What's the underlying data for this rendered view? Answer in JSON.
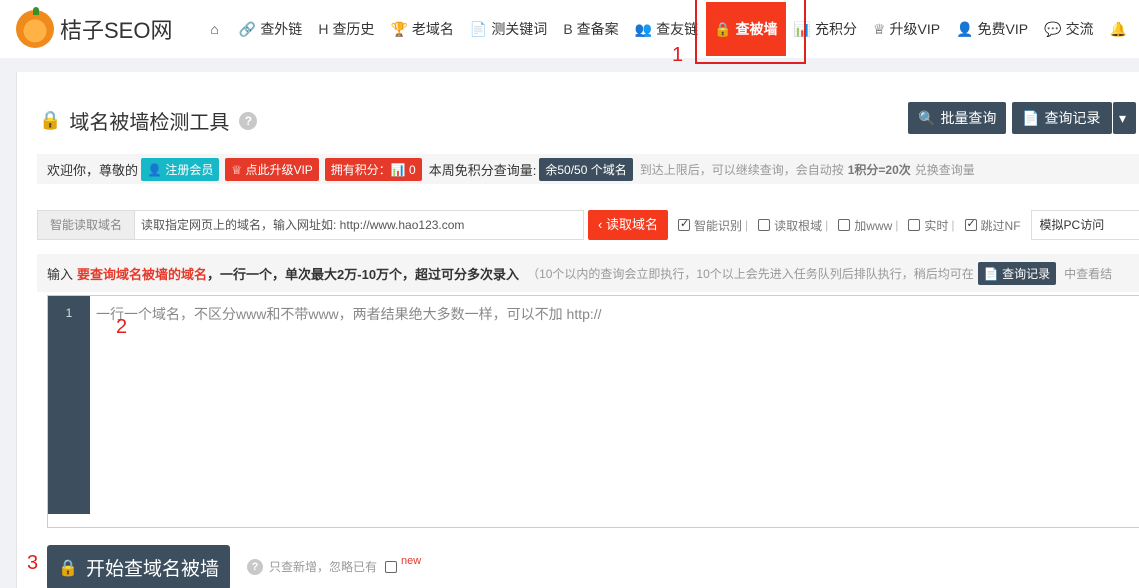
{
  "site": {
    "logo_text": "桔子SEO网"
  },
  "nav": [
    {
      "icon": "home-icon",
      "glyph": "⌂",
      "label": ""
    },
    {
      "icon": "link-icon",
      "glyph": "🔗",
      "label": "查外链"
    },
    {
      "icon": "history-icon",
      "glyph": "H",
      "label": "查历史"
    },
    {
      "icon": "trophy-icon",
      "glyph": "🏆",
      "label": "老域名"
    },
    {
      "icon": "doc-icon",
      "glyph": "📄",
      "label": "测关键词"
    },
    {
      "icon": "record-icon",
      "glyph": "B",
      "label": "查备案"
    },
    {
      "icon": "friends-icon",
      "glyph": "👥",
      "label": "查友链"
    },
    {
      "icon": "lock-icon",
      "glyph": "🔒",
      "label": "查被墙",
      "active": true
    },
    {
      "icon": "bar-chart-icon",
      "glyph": "📊",
      "label": "充积分"
    },
    {
      "icon": "crown-icon",
      "glyph": "♕",
      "label": "升级VIP"
    },
    {
      "icon": "user-add-icon",
      "glyph": "👤",
      "label": "免费VIP"
    },
    {
      "icon": "chat-icon",
      "glyph": "💬",
      "label": "交流"
    },
    {
      "icon": "bell-icon",
      "glyph": "🔔",
      "label": ""
    }
  ],
  "annotations": {
    "a1": "1",
    "a2": "2",
    "a3": "3"
  },
  "page": {
    "title": "域名被墙检测工具",
    "help": "?",
    "batch_query": "批量查询",
    "query_records": "查询记录",
    "dropdown_caret": "▾"
  },
  "welcome": {
    "greeting": "欢迎你，尊敬的",
    "register_tag": "注册会员",
    "upgrade_tag": "点此升级VIP",
    "points_tag": "拥有积分：📊 0",
    "weekly_label": "本周免积分查询量:",
    "weekly_tag": "余50/50 个域名",
    "note_pre": "到达上限后，可以继续查询，会自动按",
    "note_bold": "1积分=20次",
    "note_post": "兑换查询量"
  },
  "reader": {
    "label": "智能读取域名",
    "placeholder": "读取指定网页上的域名，输入网址如: http://www.hao123.com",
    "button": "读取域名",
    "options": [
      {
        "label": "智能识别",
        "checked": true
      },
      {
        "label": "读取根域",
        "checked": false
      },
      {
        "label": "加www",
        "checked": false
      },
      {
        "label": "实时",
        "checked": false
      },
      {
        "label": "跳过NF",
        "checked": true
      }
    ],
    "select_value": "模拟PC访问"
  },
  "hint": {
    "prefix": "输入",
    "red": "要查询域名被墙的域名",
    "bold": "，一行一个，单次最大2万-10万个，超过可分多次录入",
    "muted": "（10个以内的查询会立即执行，10个以上会先进入任务队列后排队执行，稍后均可在",
    "btn": "查询记录",
    "tail": "中查看结"
  },
  "editor": {
    "line_no": "1",
    "placeholder": "一行一个域名，不区分www和不带www，两者结果绝大多数一样，可以不加 http://"
  },
  "start": {
    "button": "开始查域名被墙",
    "only_new": "只查新增，忽略已有",
    "new_tag": "new"
  }
}
